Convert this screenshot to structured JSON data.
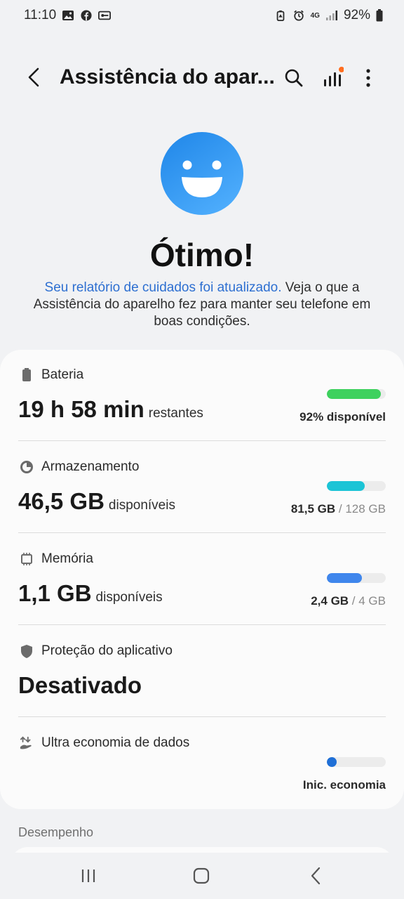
{
  "status_bar": {
    "time": "11:10",
    "left_icons": [
      "gallery-icon",
      "facebook-icon",
      "vpn-key-icon"
    ],
    "right_icons": [
      "battery-saver-icon",
      "alarm-icon",
      "4g-data-icon",
      "signal-icon",
      "battery-icon"
    ],
    "network": "4G",
    "battery_percent": "92%"
  },
  "app_bar": {
    "title": "Assistência do apar...",
    "icons": [
      "back-arrow-icon",
      "search-icon",
      "signal-chart-icon",
      "more-vert-icon"
    ],
    "notification_dot_color": "#ff6d1f"
  },
  "hero": {
    "face_icon": "smiley-face-icon",
    "title": "Ótimo!",
    "link_text": "Seu relatório de cuidados foi atualizado.",
    "description": " Veja o que a Assistência do aparelho fez para manter seu telefone em boas condições."
  },
  "items": [
    {
      "icon": "battery-icon",
      "label": "Bateria",
      "value": "19 h 58 min",
      "unit": "restantes",
      "meta_main": "92% disponível",
      "meta_muted": "",
      "level": 0.92,
      "color": "#3ed15e"
    },
    {
      "icon": "pie-chart-icon",
      "label": "Armazenamento",
      "value": "46,5 GB",
      "unit": "disponíveis",
      "meta_main": "81,5 GB",
      "meta_muted": " / 128 GB",
      "level": 0.64,
      "color": "#1cc4d6"
    },
    {
      "icon": "memory-chip-icon",
      "label": "Memória",
      "value": "1,1 GB",
      "unit": "disponíveis",
      "meta_main": "2,4 GB",
      "meta_muted": " / 4 GB",
      "level": 0.6,
      "color": "#3f86ec"
    },
    {
      "icon": "shield-icon",
      "label": "Proteção do aplicativo",
      "value": "Desativado",
      "unit": ""
    },
    {
      "icon": "data-saver-icon",
      "label": "Ultra economia de dados",
      "value": "",
      "unit": "",
      "meta_main": "Inic. economia",
      "meta_muted": "",
      "level": 0.0,
      "color": "#1f6fd6"
    }
  ],
  "section": {
    "title": "Desempenho"
  },
  "nav": {
    "icons": [
      "recents-icon",
      "home-icon",
      "back-icon"
    ]
  }
}
